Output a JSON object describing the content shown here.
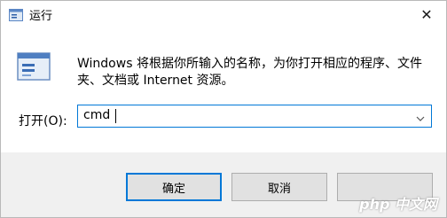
{
  "window": {
    "title": "运行",
    "close_icon": "close-icon",
    "app_icon": "run-icon"
  },
  "description": {
    "line1": "Windows 将根据你所输入的名称，为你打开相应的程序、文件",
    "line2": "夹、文档或 Internet 资源。"
  },
  "open_field": {
    "label": "打开(O):",
    "value": "cmd"
  },
  "buttons": {
    "ok": "确定",
    "cancel": "取消",
    "browse": ""
  },
  "watermark": "php 中文网",
  "colors": {
    "accent": "#0078d7",
    "footer_bg": "#f0f0f0",
    "button_bg": "#e1e1e1"
  }
}
